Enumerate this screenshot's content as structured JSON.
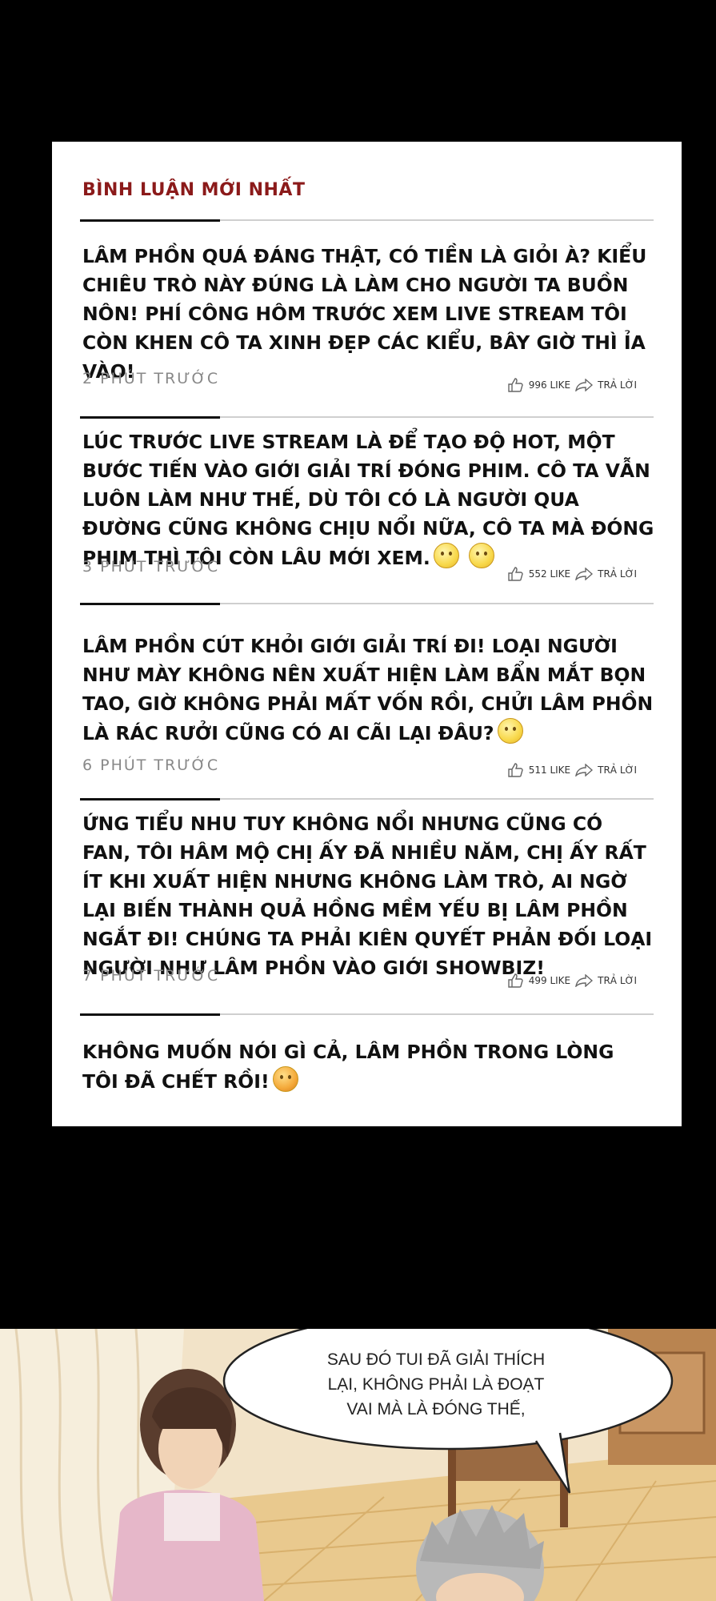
{
  "panel": {
    "title": "BÌNH LUẬN MỚI NHẤT",
    "comments": [
      {
        "text": "LÂM PHỒN QUÁ ĐÁNG THẬT, CÓ TIỀN LÀ GIỎI À? KIỂU CHIÊU TRÒ NÀY ĐÚNG LÀ LÀM CHO NGƯỜI TA BUỒN NÔN! PHÍ CÔNG HÔM TRƯỚC XEM LIVE STREAM TÔI CÒN KHEN CÔ TA XINH ĐẸP CÁC KIỂU, BÂY GIỜ THÌ ỈA VÀO!",
        "time": "2 PHÚT TRƯỚC",
        "likes": "996 LIKE",
        "reply": "TRẢ LỜI"
      },
      {
        "text": "LÚC TRƯỚC LIVE STREAM LÀ ĐỂ TẠO ĐỘ HOT, MỘT BƯỚC TIẾN VÀO GIỚI GIẢI TRÍ ĐÓNG PHIM. CÔ TA VẪN LUÔN LÀM NHƯ THẾ, DÙ TÔI CÓ LÀ NGƯỜI QUA ĐƯỜNG CŨNG KHÔNG CHỊU NỔI NỮA, CÔ TA MÀ ĐÓNG PHIM THÌ TÔI CÒN LÂU MỚI XEM.",
        "time": "3 PHÚT TRƯỚC",
        "likes": "552 LIKE",
        "reply": "TRẢ LỜI"
      },
      {
        "text": "LÂM PHỒN CÚT KHỎI GIỚI GIẢI TRÍ ĐI! LOẠI NGƯỜI NHƯ MÀY KHÔNG NÊN XUẤT HIỆN LÀM BẨN MẮT BỌN TAO, GIỜ KHÔNG PHẢI MẤT VỐN RỒI, CHỬI LÂM PHỒN LÀ RÁC RƯỞI CŨNG CÓ AI CÃI LẠI ĐÂU?",
        "time": "6 PHÚT TRƯỚC",
        "likes": "511 LIKE",
        "reply": "TRẢ LỜI"
      },
      {
        "text": "ỨNG TIỂU NHU TUY KHÔNG NỔI NHƯNG CŨNG CÓ FAN, TÔI HÂM MỘ CHỊ ẤY ĐÃ NHIỀU NĂM, CHỊ ẤY RẤT ÍT KHI XUẤT HIỆN NHƯNG KHÔNG LÀM TRÒ, AI NGỜ LẠI BIẾN THÀNH QUẢ HỒNG MỀM YẾU BỊ LÂM PHỒN NGẮT ĐI! CHÚNG TA PHẢI KIÊN QUYẾT PHẢN ĐỐI LOẠI NGƯỜI NHƯ LÂM PHỒN VÀO GIỚI SHOWBIZ!",
        "time": "7 PHÚT TRƯỚC",
        "likes": "499 LIKE",
        "reply": "TRẢ LỜI"
      },
      {
        "text": "KHÔNG MUỐN NÓI GÌ CẢ, LÂM PHỒN TRONG LÒNG TÔI ĐÃ CHẾT RỒI!"
      }
    ]
  },
  "speech_bubble": {
    "text": "SAU ĐÓ TUI ĐÃ GIẢI THÍCH LẠI, KHÔNG PHẢI LÀ ĐOẠT VAI MÀ LÀ ĐÓNG THẾ,"
  },
  "colors": {
    "title": "#8b1a1a",
    "panel_bg": "#ffffff",
    "page_bg": "#000000"
  }
}
